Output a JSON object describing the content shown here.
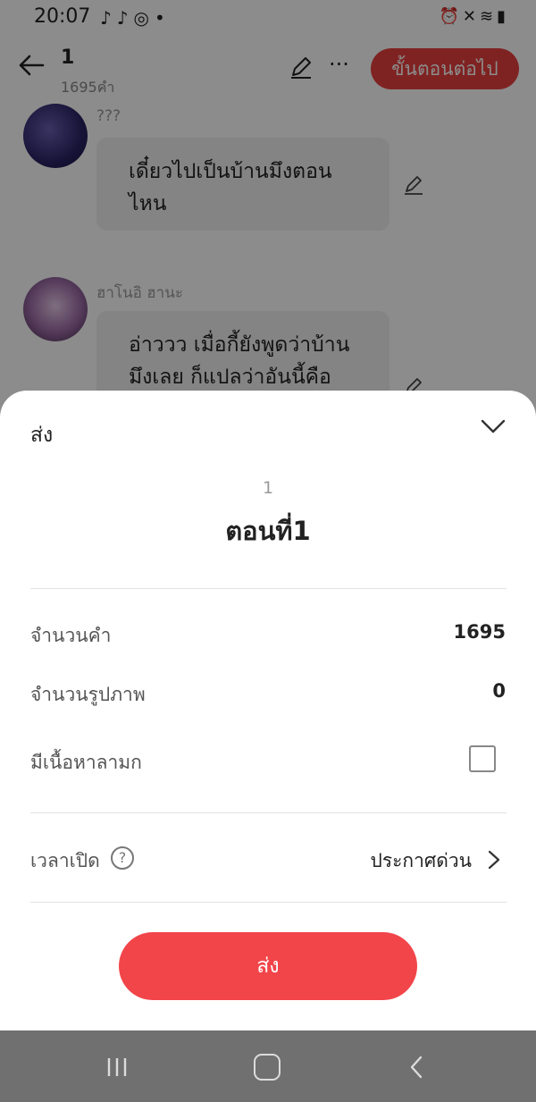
{
  "status_bar": {
    "time": "20:07",
    "left_icons": [
      "tiktok-icon",
      "tiktok-icon",
      "instagram-icon",
      "dot-icon"
    ],
    "right_icons": [
      "alarm-icon",
      "mute-icon",
      "wifi-icon",
      "signal-icon",
      "battery-icon"
    ]
  },
  "header": {
    "title": "1",
    "subtitle": "1695คำ",
    "next_button": "ขั้นตอนต่อไป"
  },
  "messages": [
    {
      "sender": "???",
      "text": "เดี๋ยวไปเป็นบ้านมึงตอนไหน"
    },
    {
      "sender": "ฮาโนอิ ฮานะ",
      "text": "อ่าววว เมื่อกี้ยังพูดว่าบ้านมึงเลย ก็แปลว่าอันนี้คือ"
    }
  ],
  "sheet": {
    "title": "ส่ง",
    "episode_number": "1",
    "episode_title": "ตอนที่1",
    "word_count_label": "จำนวนคำ",
    "word_count_value": "1695",
    "image_count_label": "จำนวนรูปภาพ",
    "image_count_value": "0",
    "explicit_label": "มีเนื้อหาลามก",
    "explicit_checked": false,
    "open_time_label": "เวลาเปิด",
    "open_time_value": "ประกาศด่วน",
    "send_button": "ส่ง"
  },
  "colors": {
    "accent": "#f2454a",
    "next_button": "#e8413f"
  }
}
